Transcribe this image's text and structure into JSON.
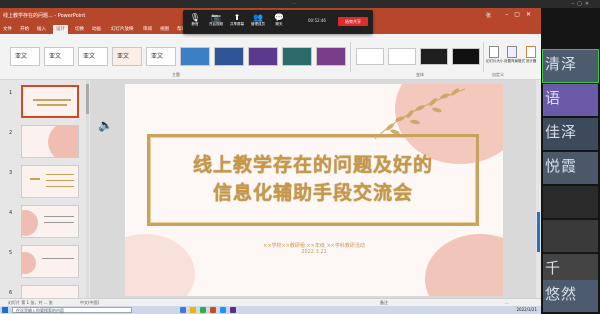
{
  "meeting": {
    "window_title": "...",
    "buttons": [
      {
        "label": "静音",
        "icon": "mic-icon"
      },
      {
        "label": "开启视频",
        "icon": "camera-icon"
      },
      {
        "label": "共享屏幕",
        "icon": "share-icon"
      },
      {
        "label": "管理成员",
        "icon": "members-icon"
      },
      {
        "label": "聊天",
        "icon": "chat-icon"
      }
    ],
    "duration": "00:52:46",
    "end_label": "结束共享"
  },
  "ppt": {
    "titlebar_text": "线上教学存在的问题...  -  PowerPoint",
    "user": "张",
    "tabs": [
      "文件",
      "开始",
      "插入",
      "设计",
      "切换",
      "动画",
      "幻灯片放映",
      "审阅",
      "视图",
      "帮助",
      "告诉我"
    ],
    "active_tab": "设计",
    "ribbon": {
      "themes": [
        "亚文",
        "亚文",
        "亚文",
        "亚文",
        "亚文",
        "亚文"
      ],
      "themes_group_label": "主题",
      "variants_group_label": "变体",
      "buttons": [
        {
          "label": "幻灯片大小"
        },
        {
          "label": "设置背景格式"
        }
      ],
      "customize_label": "自定义",
      "designer_label": "设计器"
    },
    "colors": {
      "accent": "#b7472a",
      "gold": "#c9a25c",
      "pink": "#f0bdb2"
    },
    "thumbnails": [
      "1",
      "2",
      "3",
      "4",
      "5",
      "6"
    ],
    "slide": {
      "title_line1": "线上教学存在的问题及好的",
      "title_line2": "信息化辅助手段交流会",
      "subtitle": "××学校××教研组 ××年级 ××学科教研活动",
      "date": "2022.3.21"
    },
    "status": {
      "slide_info": "幻灯片 第 1 张，共 ... 张",
      "language": "中文(中国)",
      "notes": "备注",
      "zoom": "..."
    }
  },
  "taskbar": {
    "search_placeholder": "在这里输入你要搜索的内容",
    "time": "2022/3/21"
  },
  "participants": [
    {
      "name": "清泽",
      "color": "#4c5b6d"
    },
    {
      "name": "语",
      "color": "#6a5aa8"
    },
    {
      "name": "佳泽",
      "color": "#3d4a5c"
    },
    {
      "name": "悦霞",
      "color": "#4a586a"
    },
    {
      "name": "",
      "color": "#2a2a2a"
    },
    {
      "name": "",
      "color": "#3a3a3a"
    },
    {
      "name": "",
      "color": "#2f2f2f"
    },
    {
      "name": "千",
      "color": "#444"
    },
    {
      "name": "悠然",
      "color": "#4c5b6d"
    }
  ]
}
